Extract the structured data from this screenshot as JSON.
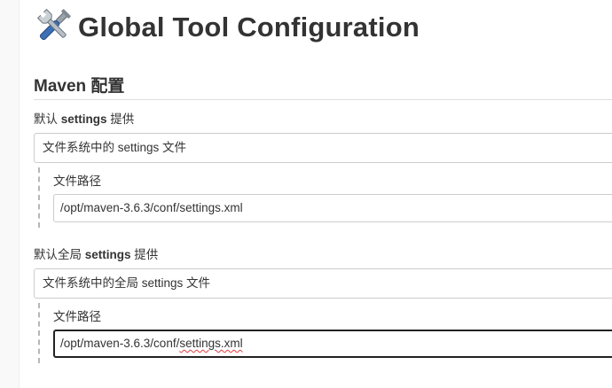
{
  "page": {
    "title": "Global Tool Configuration",
    "title_icon": "tools-icon"
  },
  "maven": {
    "section_title": "Maven 配置",
    "default_settings": {
      "label_prefix": "默认 ",
      "label_keyword": "settings",
      "label_suffix": " 提供",
      "selected_option": "文件系统中的 settings 文件",
      "path_label": "文件路径",
      "path_value": "/opt/maven-3.6.3/conf/settings.xml"
    },
    "global_settings": {
      "label_prefix": "默认全局 ",
      "label_keyword": "settings",
      "label_suffix": " 提供",
      "selected_option": "文件系统中的全局 settings 文件",
      "path_label": "文件路径",
      "path_value_before": "/opt/maven-3.6.3/conf/",
      "path_value_misspelled": "settings.xml"
    }
  },
  "colors": {
    "text": "#333333",
    "border": "#cccccc",
    "focus_border": "#222222",
    "spellcheck": "#e03b3b"
  }
}
